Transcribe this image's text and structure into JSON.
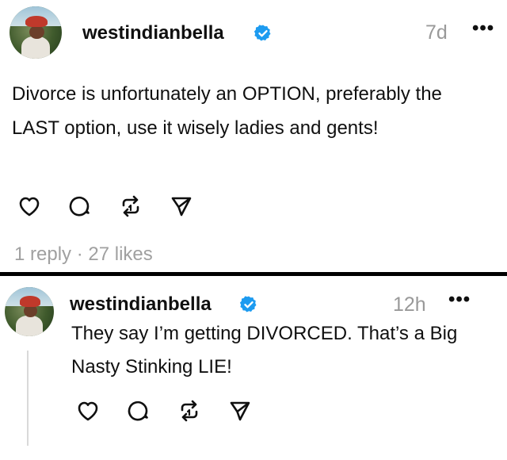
{
  "colors": {
    "text": "#101010",
    "muted": "#999999",
    "verified": "#1d9bf0",
    "divider": "#000000"
  },
  "posts": [
    {
      "username": "westindianbella",
      "time": "7d",
      "more": "•••",
      "text": "Divorce is unfortunately an OPTION, preferably the LAST option, use it wisely ladies and gents!",
      "replies": "1 reply",
      "separator": "·",
      "likes": "27 likes",
      "icons": [
        "heart-icon",
        "comment-icon",
        "repost-icon",
        "share-icon",
        "verified-badge-icon"
      ]
    },
    {
      "username": "westindianbella",
      "time": "12h",
      "more": "•••",
      "text": "They say I’m getting DIVORCED. That’s a Big Nasty Stinking LIE!",
      "icons": [
        "heart-icon",
        "comment-icon",
        "repost-icon",
        "share-icon",
        "verified-badge-icon"
      ]
    }
  ]
}
